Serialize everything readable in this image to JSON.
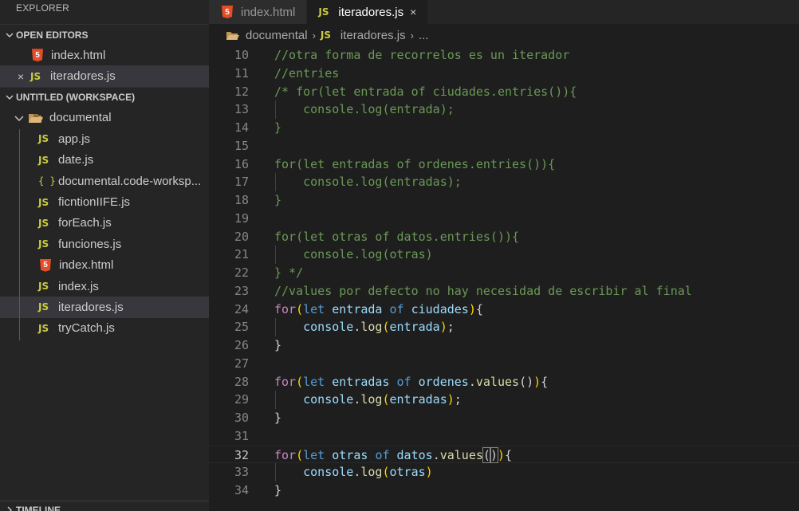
{
  "sidebar": {
    "title": "EXPLORER",
    "open_editors_header": "OPEN EDITORS",
    "open_editors": [
      {
        "label": "index.html",
        "icon": "html5-icon",
        "selected": false
      },
      {
        "label": "iteradores.js",
        "icon": "js-icon",
        "selected": true,
        "close": "×"
      }
    ],
    "workspace_header": "UNTITLED (WORKSPACE)",
    "folder": "documental",
    "files": [
      {
        "label": "app.js",
        "icon": "JS"
      },
      {
        "label": "date.js",
        "icon": "JS"
      },
      {
        "label": "documental.code-worksp...",
        "icon": "{ }"
      },
      {
        "label": "ficntionIIFE.js",
        "icon": "JS"
      },
      {
        "label": "forEach.js",
        "icon": "JS"
      },
      {
        "label": "funciones.js",
        "icon": "JS"
      },
      {
        "label": "index.html",
        "icon": "5"
      },
      {
        "label": "index.js",
        "icon": "JS"
      },
      {
        "label": "iteradores.js",
        "icon": "JS"
      },
      {
        "label": "tryCatch.js",
        "icon": "JS"
      }
    ],
    "timeline_header": "TIMELINE"
  },
  "tabs": [
    {
      "label": "index.html",
      "icon": "5",
      "active": false
    },
    {
      "label": "iteradores.js",
      "icon": "JS",
      "active": true,
      "close": "×"
    }
  ],
  "breadcrumb": {
    "folder": "documental",
    "file_icon": "JS",
    "file": "iteradores.js",
    "more": "..."
  },
  "icons": {
    "js_label": "JS",
    "html_label": "5",
    "chevron": "⌄",
    "chevron_right": "›"
  },
  "colors": {
    "comment": "#6a9955",
    "keyword": "#c586c0",
    "storage": "#569cd6",
    "variable": "#9cdcfe",
    "function": "#dcdcaa",
    "js_icon": "#cbcb41",
    "html_icon": "#e44d26"
  },
  "code": {
    "lines": [
      {
        "n": "10",
        "tokens": [
          [
            "c",
            "//otra forma de recorrelos es un iterador"
          ]
        ]
      },
      {
        "n": "11",
        "tokens": [
          [
            "c",
            "//entries"
          ]
        ]
      },
      {
        "n": "12",
        "tokens": [
          [
            "c",
            "/* for(let entrada of ciudades.entries()){"
          ]
        ]
      },
      {
        "n": "13",
        "tokens": [
          [
            "c",
            "    console.log(entrada);"
          ]
        ]
      },
      {
        "n": "14",
        "tokens": [
          [
            "c",
            "}"
          ]
        ]
      },
      {
        "n": "15",
        "tokens": [
          [
            "c",
            ""
          ]
        ]
      },
      {
        "n": "16",
        "tokens": [
          [
            "c",
            "for(let entradas of ordenes.entries()){"
          ]
        ]
      },
      {
        "n": "17",
        "tokens": [
          [
            "c",
            "    console.log(entradas);"
          ]
        ]
      },
      {
        "n": "18",
        "tokens": [
          [
            "c",
            "}"
          ]
        ]
      },
      {
        "n": "19",
        "tokens": [
          [
            "c",
            ""
          ]
        ]
      },
      {
        "n": "20",
        "tokens": [
          [
            "c",
            "for(let otras of datos.entries()){"
          ]
        ]
      },
      {
        "n": "21",
        "tokens": [
          [
            "c",
            "    console.log(otras)"
          ]
        ]
      },
      {
        "n": "22",
        "tokens": [
          [
            "c",
            "} */"
          ]
        ]
      },
      {
        "n": "23",
        "tokens": [
          [
            "c",
            "//values por defecto no hay necesidad de escribir al final"
          ]
        ]
      },
      {
        "n": "24",
        "tokens": [
          [
            "kw",
            "for"
          ],
          [
            "br",
            "("
          ],
          [
            "st",
            "let "
          ],
          [
            "var",
            "entrada "
          ],
          [
            "st",
            "of "
          ],
          [
            "var",
            "ciudades"
          ],
          [
            "br",
            ")"
          ],
          [
            "pl",
            "{"
          ]
        ]
      },
      {
        "n": "25",
        "tokens": [
          [
            "pl",
            "    "
          ],
          [
            "var",
            "console"
          ],
          [
            "pl",
            "."
          ],
          [
            "fn",
            "log"
          ],
          [
            "br",
            "("
          ],
          [
            "var",
            "entrada"
          ],
          [
            "br",
            ")"
          ],
          [
            "pl",
            ";"
          ]
        ]
      },
      {
        "n": "26",
        "tokens": [
          [
            "pl",
            "}"
          ]
        ]
      },
      {
        "n": "27",
        "tokens": [
          [
            "pl",
            ""
          ]
        ]
      },
      {
        "n": "28",
        "tokens": [
          [
            "kw",
            "for"
          ],
          [
            "br",
            "("
          ],
          [
            "st",
            "let "
          ],
          [
            "var",
            "entradas "
          ],
          [
            "st",
            "of "
          ],
          [
            "var",
            "ordenes"
          ],
          [
            "pl",
            "."
          ],
          [
            "fn",
            "values"
          ],
          [
            "pl",
            "()"
          ],
          [
            "br",
            ")"
          ],
          [
            "pl",
            "{"
          ]
        ]
      },
      {
        "n": "29",
        "tokens": [
          [
            "pl",
            "    "
          ],
          [
            "var",
            "console"
          ],
          [
            "pl",
            "."
          ],
          [
            "fn",
            "log"
          ],
          [
            "br",
            "("
          ],
          [
            "var",
            "entradas"
          ],
          [
            "br",
            ")"
          ],
          [
            "pl",
            ";"
          ]
        ]
      },
      {
        "n": "30",
        "tokens": [
          [
            "pl",
            "}"
          ]
        ]
      },
      {
        "n": "31",
        "tokens": [
          [
            "pl",
            ""
          ]
        ]
      },
      {
        "n": "32",
        "tokens": [
          [
            "kw",
            "for"
          ],
          [
            "br",
            "("
          ],
          [
            "st",
            "let "
          ],
          [
            "var",
            "otras "
          ],
          [
            "st",
            "of "
          ],
          [
            "var",
            "datos"
          ],
          [
            "pl",
            "."
          ],
          [
            "fn",
            "values"
          ],
          [
            "brb",
            "("
          ],
          [
            "brb",
            ")"
          ],
          [
            "br",
            ")"
          ],
          [
            "pl",
            "{"
          ]
        ]
      },
      {
        "n": "33",
        "tokens": [
          [
            "pl",
            "    "
          ],
          [
            "var",
            "console"
          ],
          [
            "pl",
            "."
          ],
          [
            "fn",
            "log"
          ],
          [
            "br",
            "("
          ],
          [
            "var",
            "otras"
          ],
          [
            "br",
            ")"
          ]
        ]
      },
      {
        "n": "34",
        "tokens": [
          [
            "pl",
            "}"
          ]
        ]
      }
    ],
    "current_line": "32"
  }
}
